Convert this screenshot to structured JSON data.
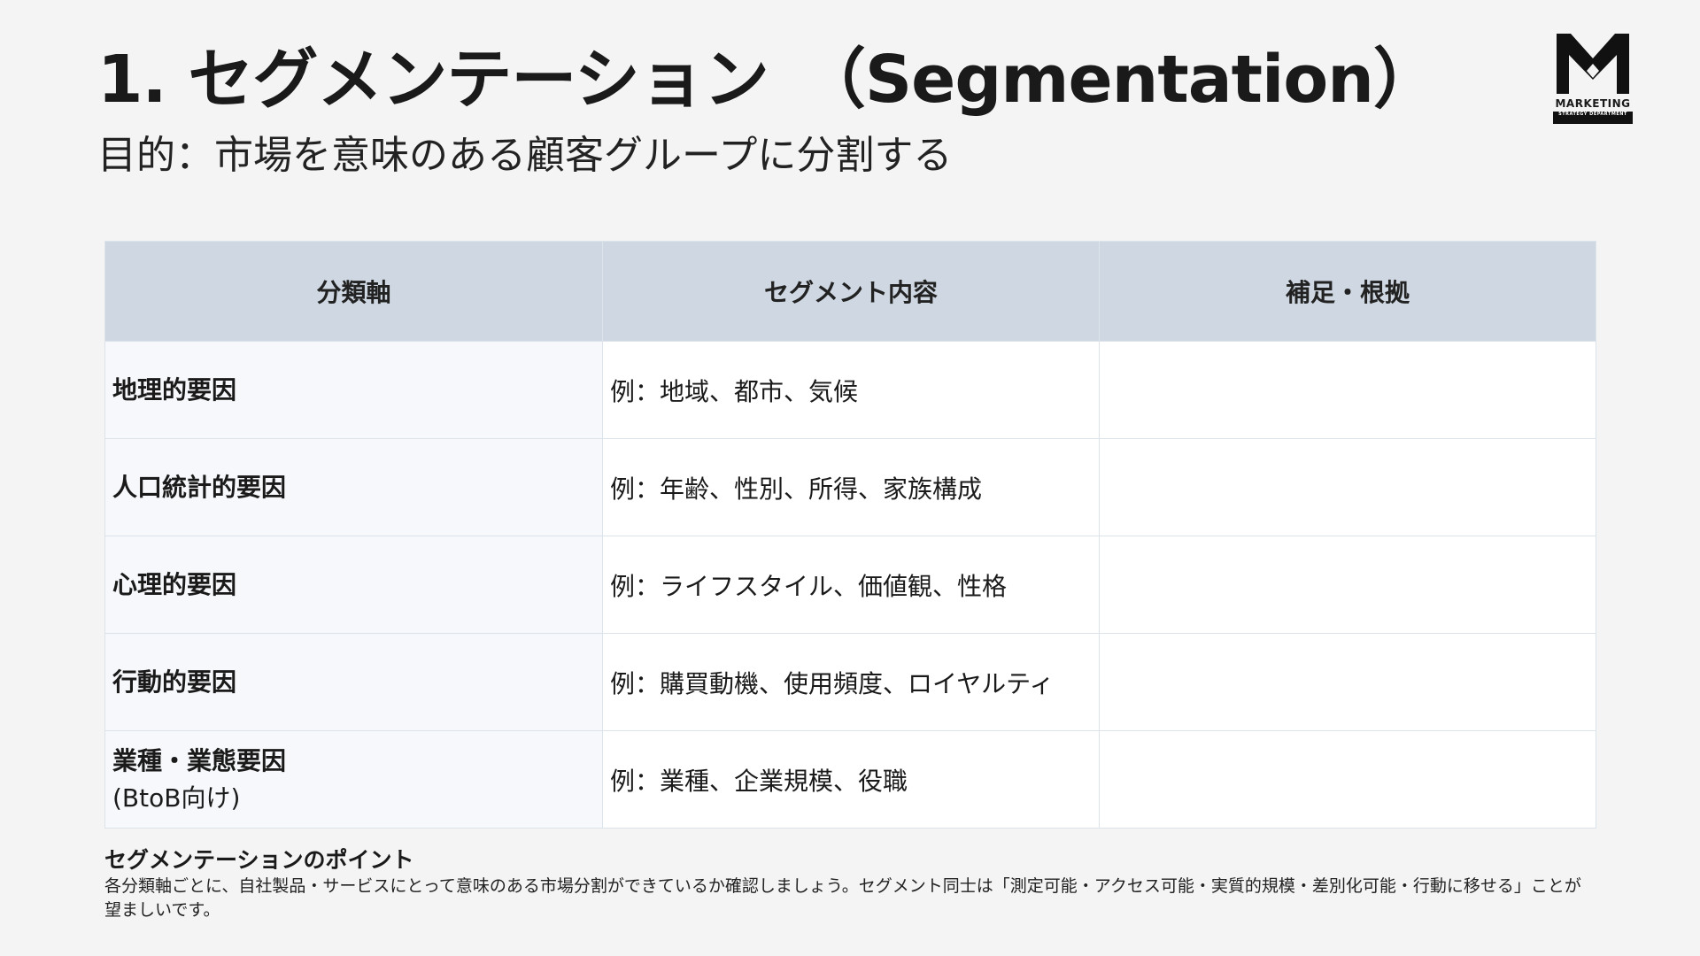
{
  "slide": {
    "title": "1. セグメンテーション　（Segmentation）",
    "subtitle": "目的：市場を意味のある顧客グループに分割する"
  },
  "logo": {
    "letter": "M",
    "text": "MARKETING",
    "subtext": "STRATEGY DEPARTMENT"
  },
  "table": {
    "headers": [
      "分類軸",
      "セグメント内容",
      "補足・根拠"
    ],
    "rows": [
      {
        "axis": "地理的要因",
        "axis_sub": "",
        "content": "例：地域、都市、気候",
        "note": ""
      },
      {
        "axis": "人口統計的要因",
        "axis_sub": "",
        "content": "例：年齢、性別、所得、家族構成",
        "note": ""
      },
      {
        "axis": "心理的要因",
        "axis_sub": "",
        "content": "例：ライフスタイル、価値観、性格",
        "note": ""
      },
      {
        "axis": "行動的要因",
        "axis_sub": "",
        "content": "例：購買動機、使用頻度、ロイヤルティ",
        "note": ""
      },
      {
        "axis": "業種・業態要因",
        "axis_sub": "(BtoB向け)",
        "content": "例：業種、企業規模、役職",
        "note": ""
      }
    ]
  },
  "point": {
    "title": "セグメンテーションのポイント",
    "body": "各分類軸ごとに、自社製品・サービスにとって意味のある市場分割ができているか確認しましょう。セグメント同士は「測定可能・アクセス可能・実質的規模・差別化可能・行動に移せる」ことが望ましいです。"
  },
  "colors": {
    "background": "#f4f4f4",
    "header_fill": "#cfd8e2",
    "axis_fill": "#f6f8fb",
    "border": "#dde3ea"
  }
}
